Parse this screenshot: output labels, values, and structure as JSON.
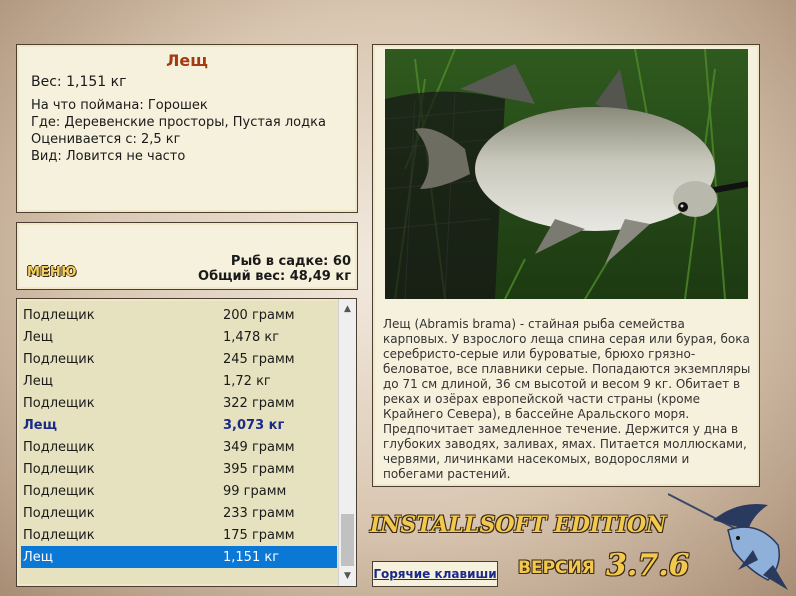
{
  "fish_info": {
    "title": "Лещ",
    "weight": "Вес: 1,151 кг",
    "bait": "На что поймана: Горошек",
    "location": "Где: Деревенские просторы, Пустая лодка",
    "value": "Оценивается с: 2,5 кг",
    "kind": "Вид: Ловится не часто"
  },
  "summary": {
    "menu_label": "МЕНЮ",
    "fish_count": "Рыб в садке: 60",
    "total_weight": "Общий вес: 48,49 кг"
  },
  "catch_list": [
    {
      "name": "Подлещик",
      "weight": "200 грамм"
    },
    {
      "name": "Лещ",
      "weight": "1,478 кг"
    },
    {
      "name": "Подлещик",
      "weight": "245 грамм"
    },
    {
      "name": "Лещ",
      "weight": "1,72 кг"
    },
    {
      "name": "Подлещик",
      "weight": "322 грамм"
    },
    {
      "name": "Лещ",
      "weight": "3,073 кг"
    },
    {
      "name": "Подлещик",
      "weight": "349 грамм"
    },
    {
      "name": "Подлещик",
      "weight": "395 грамм"
    },
    {
      "name": "Подлещик",
      "weight": "99 грамм"
    },
    {
      "name": "Подлещик",
      "weight": "233 грамм"
    },
    {
      "name": "Подлещик",
      "weight": "175 грамм"
    },
    {
      "name": "Лещ",
      "weight": "1,151 кг"
    }
  ],
  "description": "Лещ (Abramis brama) - стайная рыба семейства карповых. У взрослого леща спина серая или бурая, бока серебристо-серые или буроватые, брюхо грязно-беловатое, все плавники серые. Попадаются экземпляры до 71 см длиной, 36 см высотой и весом 9 кг. Обитает в реках и озёрах европейской части страны (кроме Крайнего Севера), в бассейне Аральского моря. Предпочитает замедленное течение. Держится у дна в глубоких заводях, заливах, ямах. Питается моллюсками, червями, личинками насекомых, водорослями и побегами растений.",
  "footer": {
    "brand": "INSTALLSOFT EDITION",
    "hotkeys": "Горячие клавиши",
    "version_label": "ВЕРСИЯ",
    "version_number": "3.7.6"
  },
  "colors": {
    "title": "#a33a12",
    "highlight": "#1a2a8a",
    "selection": "#0a78d4",
    "panel": "#f6f1dc",
    "list": "#e6e2bf"
  }
}
